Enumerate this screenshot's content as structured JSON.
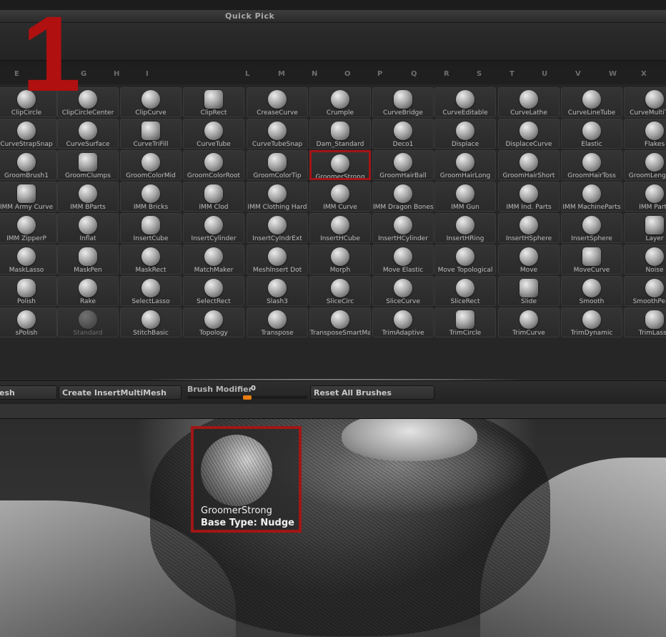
{
  "annotation_number": "1",
  "header": {
    "title": "Quick Pick"
  },
  "alpha_row": [
    "E",
    "G",
    "H",
    "I",
    "",
    "L",
    "M",
    "N",
    "O",
    "P",
    "Q",
    "R",
    "S",
    "T",
    "U",
    "V",
    "W",
    "X"
  ],
  "brushes": [
    [
      "ClipCircle",
      "ClipCircleCenter",
      "ClipCurve",
      "ClipRect",
      "CreaseCurve",
      "Crumple",
      "CurveBridge",
      "CurveEditable",
      "CurveLathe",
      "CurveLineTube",
      "CurveMultiTube"
    ],
    [
      "CurveStrapSnap",
      "CurveSurface",
      "CurveTriFill",
      "CurveTube",
      "CurveTubeSnap",
      "Dam_Standard",
      "Deco1",
      "Displace",
      "DisplaceCurve",
      "Elastic",
      "Flakes"
    ],
    [
      "GroomBrush1",
      "GroomClumps",
      "GroomColorMid",
      "GroomColorRoot",
      "GroomColorTip",
      "GroomerStrong",
      "GroomHairBall",
      "GroomHairLong",
      "GroomHairShort",
      "GroomHairToss",
      "GroomLengthen"
    ],
    [
      "IMM  Army  Curve",
      "IMM  BParts",
      "IMM  Bricks",
      "IMM  Clod",
      "IMM  Clothing  Hard",
      "IMM  Curve",
      "IMM  Dragon  Bones",
      "IMM  Gun",
      "IMM  Ind.  Parts",
      "IMM  MachineParts",
      "IMM  Parts"
    ],
    [
      "IMM  ZipperP",
      "Inflat",
      "InsertCube",
      "InsertCylinder",
      "InsertCylndrExt",
      "InsertHCube",
      "InsertHCylinder",
      "InsertHRing",
      "InsertHSphere",
      "InsertSphere",
      "Layer"
    ],
    [
      "MaskLasso",
      "MaskPen",
      "MaskRect",
      "MatchMaker",
      "MeshInsert  Dot",
      "Morph",
      "Move  Elastic",
      "Move  Topological",
      "Move",
      "MoveCurve",
      "Noise"
    ],
    [
      "Polish",
      "Rake",
      "SelectLasso",
      "SelectRect",
      "Slash3",
      "SliceCirc",
      "SliceCurve",
      "SliceRect",
      "Slide",
      "Smooth",
      "SmoothPeaks"
    ],
    [
      "sPolish",
      "Standard",
      "StitchBasic",
      "Topology",
      "Transpose",
      "TransposeSmartMask",
      "TrimAdaptive",
      "TrimCircle",
      "TrimCurve",
      "TrimDynamic",
      "TrimLasso"
    ]
  ],
  "selected_brush": "GroomerStrong",
  "disabled_brush": "Standard",
  "toolbar": {
    "left_button": "esh",
    "create_button": "Create  InsertMultiMesh",
    "modifier_label": "Brush  Modifier",
    "modifier_value": "0",
    "reset_button": "Reset  All  Brushes"
  },
  "tooltip": {
    "name": "GroomerStrong",
    "base_type": "Base  Type:  Nudge"
  },
  "colors": {
    "highlight": "#a11616",
    "accent": "#e97c12"
  }
}
